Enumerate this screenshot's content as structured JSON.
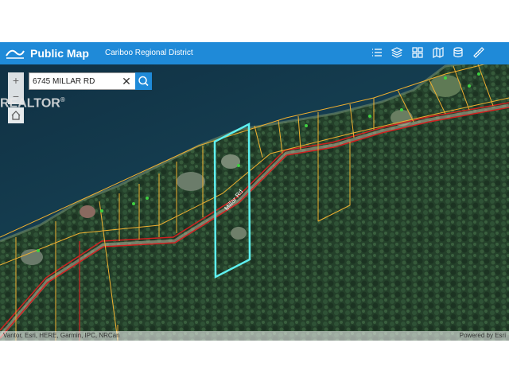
{
  "header": {
    "title": "Public Map",
    "subtitle": "Cariboo Regional District"
  },
  "toolbar": {
    "tools": [
      "list-icon",
      "layers-icon",
      "grid-icon",
      "edit-map-icon",
      "database-icon",
      "measure-icon"
    ]
  },
  "search": {
    "value": "6745 MILLAR RD"
  },
  "map": {
    "road_label": "Millar Rd",
    "watermark": "REALTOR",
    "zoom_in": "+",
    "zoom_out": "−"
  },
  "attribution": {
    "left": "Vantor, Esri, HERE, Garmin, IPC, NRCan",
    "right": "Powered by Esri"
  },
  "colors": {
    "header_bg": "#1f8ad8",
    "parcel_line": "#f0b030",
    "selected_parcel": "#5ef0f0",
    "road": "#d02020",
    "water": "#123a4e",
    "forest": "#2a4a30"
  }
}
